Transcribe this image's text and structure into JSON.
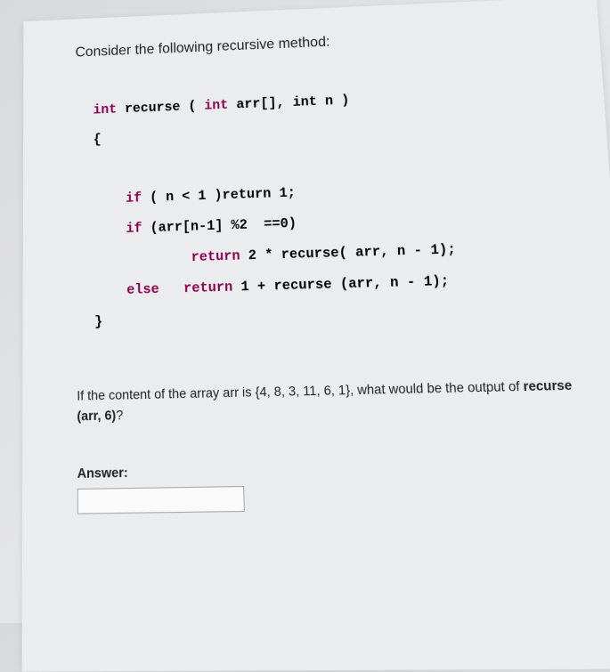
{
  "question": {
    "intro": "Consider the following recursive method:",
    "code": {
      "line1_pre": "int",
      "line1_mid": " recurse ( ",
      "line1_kw2": "int",
      "line1_rest": " arr[], int n )",
      "line2": "{",
      "line3_pre": "    if",
      "line3_rest": " ( n < 1 )return 1;",
      "line4_pre": "    if",
      "line4_rest": " (arr[n-1] %2  ==0)",
      "line5_pre": "            return",
      "line5_rest": " 2 * recurse( arr, n - 1);",
      "line6_pre": "    else",
      "line6_mid": "   return",
      "line6_rest": " 1 + recurse (arr, n - 1);",
      "line7": "}"
    },
    "followup_part1": "If the content of the array arr is {4, 8, 3, 11, 6, 1}, what would be the output of ",
    "followup_bold": "recurse (arr, 6)",
    "followup_part2": "?",
    "answer_label": "Answer:",
    "answer_value": ""
  }
}
